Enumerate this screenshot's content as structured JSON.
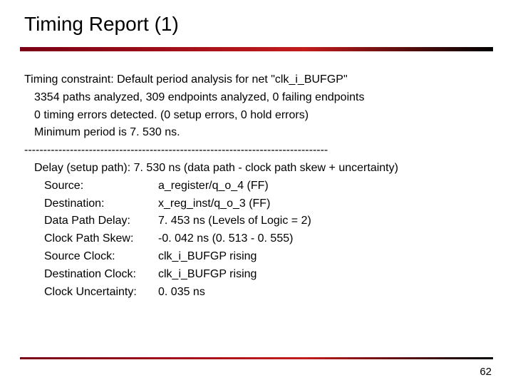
{
  "title": "Timing Report (1)",
  "constraint_line": "Timing constraint: Default period analysis for net \"clk_i_BUFGP\"",
  "paths_line": "3354 paths analyzed, 309 endpoints analyzed, 0 failing endpoints",
  "errors_line": "0 timing errors detected. (0 setup errors, 0 hold errors)",
  "min_period_line": "Minimum period is   7. 530 ns.",
  "separator": "--------------------------------------------------------------------------------",
  "delay_line": "Delay (setup path):     7. 530 ns (data path - clock path skew + uncertainty)",
  "fields": {
    "source": {
      "label": "Source:",
      "value": "a_register/q_o_4 (FF)"
    },
    "destination": {
      "label": "Destination:",
      "value": "x_reg_inst/q_o_3 (FF)"
    },
    "data_path_delay": {
      "label": "Data Path Delay:",
      "value": "7. 453 ns (Levels of Logic = 2)"
    },
    "clock_path_skew": {
      "label": "Clock Path Skew:",
      "value": " -0. 042 ns (0. 513 - 0. 555)"
    },
    "source_clock": {
      "label": "Source Clock:",
      "value": "clk_i_BUFGP rising"
    },
    "dest_clock": {
      "label": "Destination Clock:",
      "value": "clk_i_BUFGP rising"
    },
    "clock_uncert": {
      "label": "Clock Uncertainty:",
      "value": "0. 035 ns"
    }
  },
  "page_number": "62"
}
